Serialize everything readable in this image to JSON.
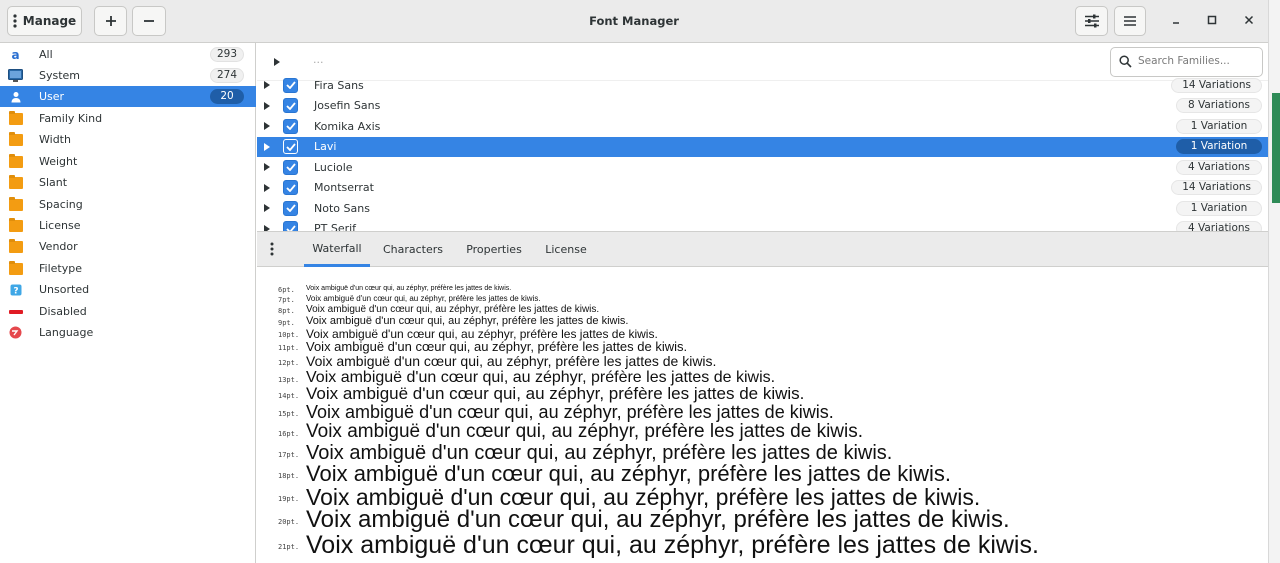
{
  "header": {
    "manage_label": "Manage",
    "title": "Font Manager"
  },
  "sidebar": {
    "items": [
      {
        "label": "All",
        "count": "293",
        "icon": "font-a-icon"
      },
      {
        "label": "System",
        "count": "274",
        "icon": "monitor-icon"
      },
      {
        "label": "User",
        "count": "20",
        "icon": "user-icon",
        "selected": true
      },
      {
        "label": "Family Kind",
        "icon": "folder-icon"
      },
      {
        "label": "Width",
        "icon": "folder-icon"
      },
      {
        "label": "Weight",
        "icon": "folder-icon"
      },
      {
        "label": "Slant",
        "icon": "folder-icon"
      },
      {
        "label": "Spacing",
        "icon": "folder-icon"
      },
      {
        "label": "License",
        "icon": "folder-icon"
      },
      {
        "label": "Vendor",
        "icon": "folder-icon"
      },
      {
        "label": "Filetype",
        "icon": "folder-icon"
      },
      {
        "label": "Unsorted",
        "icon": "unsorted-icon"
      },
      {
        "label": "Disabled",
        "icon": "disabled-icon"
      },
      {
        "label": "Language",
        "icon": "language-icon"
      }
    ]
  },
  "search": {
    "placeholder": "Search Families..."
  },
  "families": {
    "top_placeholder": "...",
    "rows": [
      {
        "name": "Fira Sans",
        "variations": "14 Variations"
      },
      {
        "name": "Josefin Sans",
        "variations": "8 Variations"
      },
      {
        "name": "Komika Axis",
        "variations": "1 Variation"
      },
      {
        "name": "Lavi",
        "variations": "1 Variation",
        "selected": true
      },
      {
        "name": "Luciole",
        "variations": "4 Variations"
      },
      {
        "name": "Montserrat",
        "variations": "14 Variations"
      },
      {
        "name": "Noto Sans",
        "variations": "1 Variation"
      },
      {
        "name": "PT Serif",
        "variations": "4 Variations"
      }
    ]
  },
  "tabs": [
    {
      "label": "Waterfall",
      "active": true
    },
    {
      "label": "Characters"
    },
    {
      "label": "Properties"
    },
    {
      "label": "License"
    }
  ],
  "waterfall": {
    "sample": "Voix ambiguë d'un cœur qui, au zéphyr, préfère les jattes de kiwis.",
    "sizes": [
      "6pt.",
      "7pt.",
      "8pt.",
      "9pt.",
      "10pt.",
      "11pt.",
      "12pt.",
      "13pt.",
      "14pt.",
      "15pt.",
      "16pt.",
      "17pt.",
      "18pt.",
      "19pt.",
      "20pt.",
      "21pt."
    ]
  },
  "colors": {
    "accent": "#3584e4",
    "folder": "#f39c12"
  }
}
